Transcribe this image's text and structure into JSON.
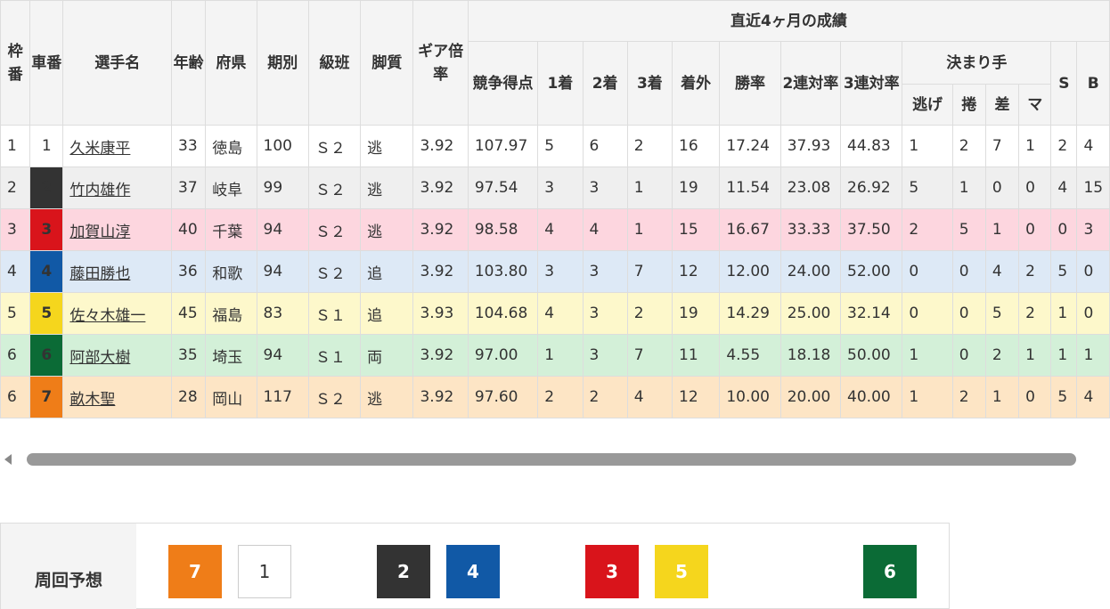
{
  "headers": {
    "waku": "枠番",
    "sha": "車番",
    "name": "選手名",
    "age": "年齢",
    "pref": "府県",
    "term": "期別",
    "rank": "級班",
    "style": "脚質",
    "gear": "ギア倍率",
    "recent": "直近4ヶ月の成績",
    "score": "競争得点",
    "first": "1着",
    "second": "2着",
    "third": "3着",
    "out": "着外",
    "win_rate": "勝率",
    "quinella_rate": "2連対率",
    "trio_rate": "3連対率",
    "kimarite": "決まり手",
    "nige": "逃げ",
    "makuri": "捲",
    "sashi": "差",
    "ma": "マ",
    "s": "S",
    "b": "B"
  },
  "colors": {
    "car1": "#ffffff",
    "car2": "#333333",
    "car3": "#d9141b",
    "car4": "#1159a6",
    "car5": "#f5d61d",
    "car6": "#0b6b36",
    "car7": "#ef7d18",
    "row_bg": [
      "#ffffff",
      "#efefef",
      "#fdd6df",
      "#dde9f6",
      "#fdf8cb",
      "#d3f0d8",
      "#fde5c5"
    ]
  },
  "riders": [
    {
      "waku": "1",
      "car": "1",
      "name": "久米康平",
      "age": "33",
      "pref": "徳島",
      "term": "100",
      "rank": "Ｓ２",
      "style": "逃",
      "gear": "3.92",
      "score": "107.97",
      "first": "5",
      "second": "6",
      "third": "2",
      "out": "16",
      "win": "17.24",
      "quinella": "37.93",
      "trio": "44.83",
      "nige": "1",
      "makuri": "2",
      "sashi": "7",
      "ma": "1",
      "s": "2",
      "b": "4"
    },
    {
      "waku": "2",
      "car": "2",
      "name": "竹内雄作",
      "age": "37",
      "pref": "岐阜",
      "term": "99",
      "rank": "Ｓ２",
      "style": "逃",
      "gear": "3.92",
      "score": "97.54",
      "first": "3",
      "second": "3",
      "third": "1",
      "out": "19",
      "win": "11.54",
      "quinella": "23.08",
      "trio": "26.92",
      "nige": "5",
      "makuri": "1",
      "sashi": "0",
      "ma": "0",
      "s": "4",
      "b": "15"
    },
    {
      "waku": "3",
      "car": "3",
      "name": "加賀山淳",
      "age": "40",
      "pref": "千葉",
      "term": "94",
      "rank": "Ｓ２",
      "style": "逃",
      "gear": "3.92",
      "score": "98.58",
      "first": "4",
      "second": "4",
      "third": "1",
      "out": "15",
      "win": "16.67",
      "quinella": "33.33",
      "trio": "37.50",
      "nige": "2",
      "makuri": "5",
      "sashi": "1",
      "ma": "0",
      "s": "0",
      "b": "3"
    },
    {
      "waku": "4",
      "car": "4",
      "name": "藤田勝也",
      "age": "36",
      "pref": "和歌",
      "term": "94",
      "rank": "Ｓ２",
      "style": "追",
      "gear": "3.92",
      "score": "103.80",
      "first": "3",
      "second": "3",
      "third": "7",
      "out": "12",
      "win": "12.00",
      "quinella": "24.00",
      "trio": "52.00",
      "nige": "0",
      "makuri": "0",
      "sashi": "4",
      "ma": "2",
      "s": "5",
      "b": "0"
    },
    {
      "waku": "5",
      "car": "5",
      "name": "佐々木雄一",
      "age": "45",
      "pref": "福島",
      "term": "83",
      "rank": "Ｓ１",
      "style": "追",
      "gear": "3.93",
      "score": "104.68",
      "first": "4",
      "second": "3",
      "third": "2",
      "out": "19",
      "win": "14.29",
      "quinella": "25.00",
      "trio": "32.14",
      "nige": "0",
      "makuri": "0",
      "sashi": "5",
      "ma": "2",
      "s": "1",
      "b": "0"
    },
    {
      "waku": "6",
      "car": "6",
      "name": "阿部大樹",
      "age": "35",
      "pref": "埼玉",
      "term": "94",
      "rank": "Ｓ１",
      "style": "両",
      "gear": "3.92",
      "score": "97.00",
      "first": "1",
      "second": "3",
      "third": "7",
      "out": "11",
      "win": "4.55",
      "quinella": "18.18",
      "trio": "50.00",
      "nige": "1",
      "makuri": "0",
      "sashi": "2",
      "ma": "1",
      "s": "1",
      "b": "1"
    },
    {
      "waku": "6",
      "car": "7",
      "name": "畝木聖",
      "age": "28",
      "pref": "岡山",
      "term": "117",
      "rank": "Ｓ２",
      "style": "逃",
      "gear": "3.92",
      "score": "97.60",
      "first": "2",
      "second": "2",
      "third": "4",
      "out": "12",
      "win": "10.00",
      "quinella": "20.00",
      "trio": "40.00",
      "nige": "1",
      "makuri": "2",
      "sashi": "1",
      "ma": "0",
      "s": "5",
      "b": "4"
    }
  ],
  "prediction": {
    "label": "周回予想",
    "boxes": [
      "7",
      "1",
      "2",
      "4",
      "3",
      "5",
      "6"
    ]
  }
}
